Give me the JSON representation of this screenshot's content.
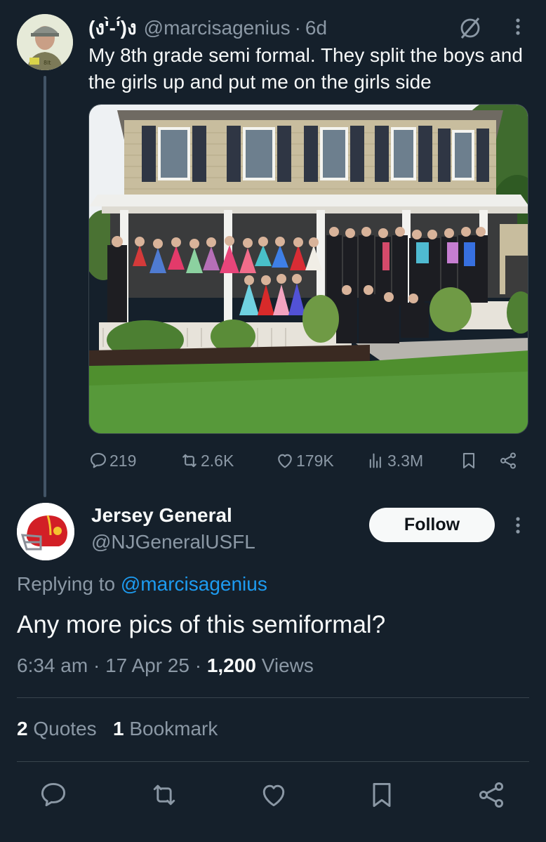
{
  "parent_tweet": {
    "display_name": "(ง'̀-'́)ง",
    "handle": "@marcisagenius",
    "separator": "·",
    "time": "6d",
    "text": "My 8th grade semi formal. They split the boys and the girls up and put me on the girls side",
    "stats": {
      "replies": "219",
      "reposts": "2.6K",
      "likes": "179K",
      "views": "3.3M"
    }
  },
  "reply_tweet": {
    "display_name": "Jersey General",
    "handle": "@NJGeneralUSFL",
    "follow_label": "Follow",
    "replying_prefix": "Replying to",
    "replying_to": "@marcisagenius",
    "text": "Any more pics of this semiformal?",
    "time": "6:34 am",
    "date": "17 Apr 25",
    "separator": "·",
    "views_count": "1,200",
    "views_label": "Views",
    "quotes_count": "2",
    "quotes_label": "Quotes",
    "bookmarks_count": "1",
    "bookmarks_label": "Bookmark"
  },
  "colors": {
    "background": "#15202b",
    "text_primary": "#f7f9f9",
    "text_secondary": "#8b98a5",
    "link": "#1d9bf0",
    "divider": "#38444d"
  },
  "icons": {
    "reply": "reply-icon",
    "repost": "repost-icon",
    "like": "heart-icon",
    "views": "views-chart-icon",
    "bookmark": "bookmark-icon",
    "share": "share-icon",
    "more": "more-vertical-icon",
    "grok": "grok-icon"
  }
}
